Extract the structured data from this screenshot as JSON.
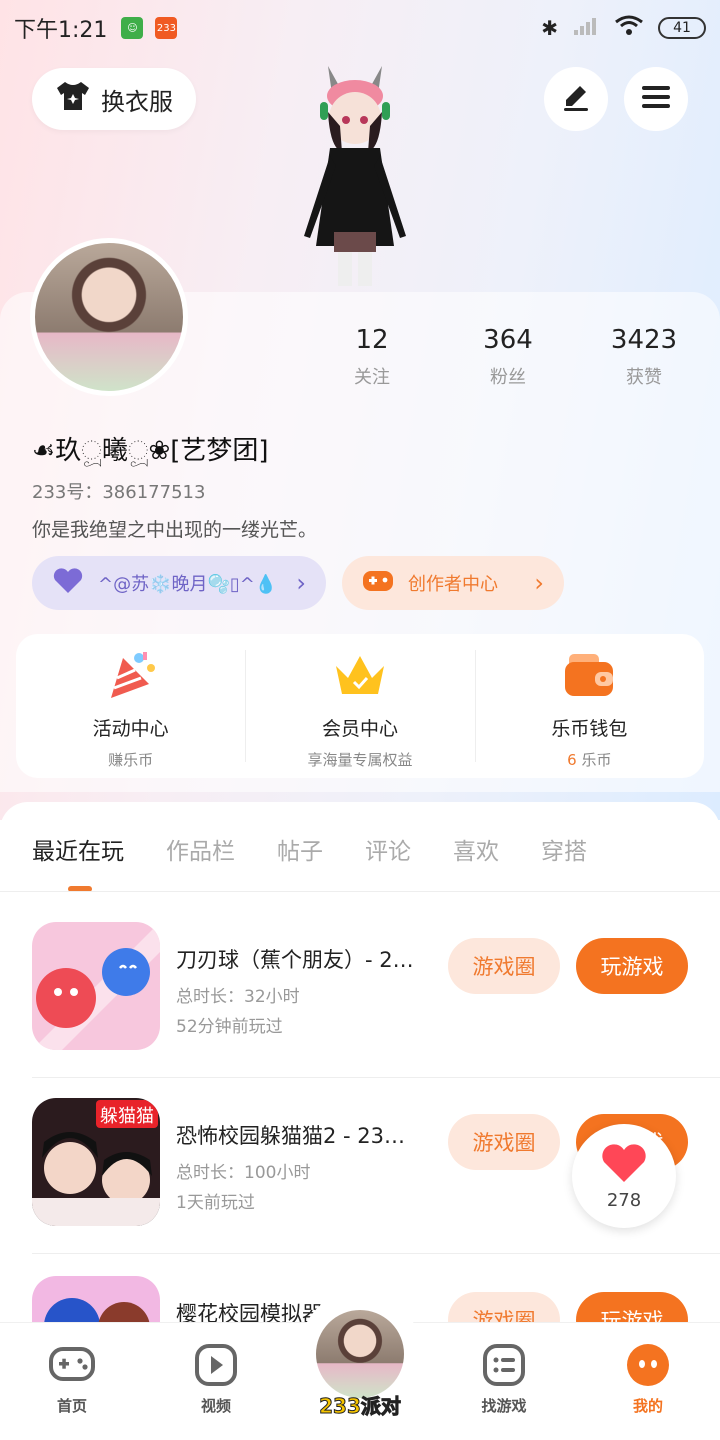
{
  "status_bar": {
    "time": "下午1:21",
    "app_badge": "233",
    "battery": "41"
  },
  "header": {
    "outfit_label": "换衣服",
    "edit_icon": "pencil-icon",
    "menu_icon": "menu-icon"
  },
  "profile": {
    "stats": [
      {
        "value": "12",
        "label": "关注"
      },
      {
        "value": "364",
        "label": "粉丝"
      },
      {
        "value": "3423",
        "label": "获赞"
      }
    ],
    "nickname": "☙玖ූ曦ූ❀[艺梦团]",
    "uid_label": "233号：",
    "uid": "386177513",
    "bio": "你是我绝望之中出现的一缕光芒。",
    "group_pill": "^@苏❄️晚月🫧▯^💧",
    "creator_pill": "创作者中心"
  },
  "quick_cards": [
    {
      "title": "活动中心",
      "sub": "赚乐币",
      "icon": "party-popper-icon"
    },
    {
      "title": "会员中心",
      "sub": "享海量专属权益",
      "icon": "crown-icon"
    },
    {
      "title": "乐币钱包",
      "sub_value": "6",
      "sub_unit": " 乐币",
      "icon": "wallet-icon"
    }
  ],
  "tabs": [
    "最近在玩",
    "作品栏",
    "帖子",
    "评论",
    "喜欢",
    "穿搭"
  ],
  "games": [
    {
      "title": "刀刃球（蕉个朋友）- 2…",
      "duration": "总时长：32小时",
      "last": "52分钟前玩过",
      "circle_btn": "游戏圈",
      "play_btn": "玩游戏"
    },
    {
      "title": "恐怖校园躲猫猫2 - 23…",
      "duration": "总时长：100小时",
      "last": "1天前玩过",
      "circle_btn": "游戏圈",
      "play_btn": "玩游戏"
    },
    {
      "title": "樱花校园模拟器 - 233…",
      "duration": "",
      "last": "",
      "circle_btn": "游戏圈",
      "play_btn": "玩游戏"
    }
  ],
  "likes_bubble": {
    "count": "278"
  },
  "bottom_nav": [
    {
      "label": "首页",
      "icon": "gamepad-icon"
    },
    {
      "label": "视频",
      "icon": "play-icon"
    },
    {
      "label": "233派对",
      "icon": "party-avatar"
    },
    {
      "label": "找游戏",
      "icon": "list-icon"
    },
    {
      "label": "我的",
      "icon": "face-icon"
    }
  ],
  "colors": {
    "accent": "#f47320",
    "accent_soft": "#fde7dc",
    "purple": "#6f64c6"
  }
}
